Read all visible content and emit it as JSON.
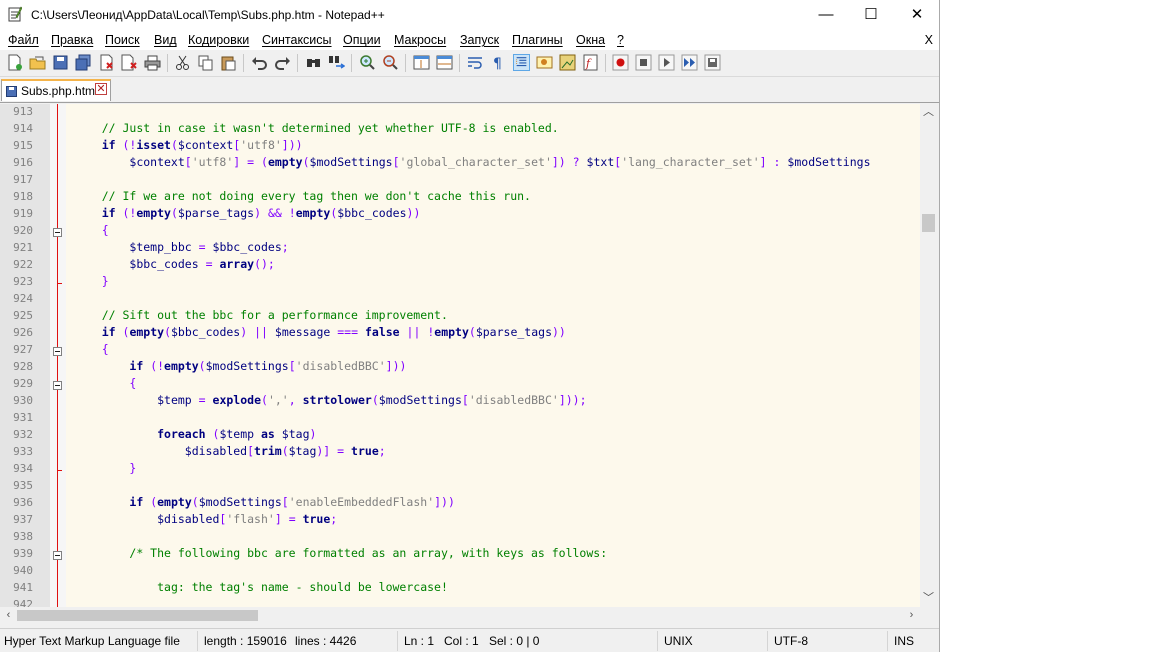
{
  "window": {
    "title": "C:\\Users\\Леонид\\AppData\\Local\\Temp\\Subs.php.htm - Notepad++",
    "minimize": "—",
    "maximize": "☐",
    "close": "✕"
  },
  "menu": {
    "items": [
      "Файл",
      "Правка",
      "Поиск",
      "Вид",
      "Кодировки",
      "Синтаксисы",
      "Опции",
      "Макросы",
      "Запуск",
      "Плагины",
      "Окна",
      "?"
    ],
    "close_doc": "X"
  },
  "toolbar": {
    "icons": [
      "new-file-icon",
      "open-file-icon",
      "save-icon",
      "save-all-icon",
      "close-icon",
      "close-all-icon",
      "print-icon",
      "cut-icon",
      "copy-icon",
      "paste-icon",
      "undo-icon",
      "redo-icon",
      "find-icon",
      "replace-icon",
      "zoom-in-icon",
      "zoom-out-icon",
      "sync-vertical-icon",
      "sync-horizontal-icon",
      "word-wrap-icon",
      "show-all-chars-icon",
      "indent-guide-icon",
      "user-language-icon",
      "document-map-icon",
      "function-list-icon",
      "record-macro-icon",
      "stop-record-icon",
      "play-macro-icon",
      "run-macro-multiple-icon",
      "save-macro-icon"
    ]
  },
  "tab": {
    "label": "Subs.php.htm",
    "close": "✕"
  },
  "editor": {
    "lines": [
      {
        "n": "913",
        "html": "",
        "fold": ""
      },
      {
        "n": "914",
        "html": "    <span class='c'>// Just in case it wasn't determined yet whether UTF-8 is enabled.</span>",
        "fold": "line"
      },
      {
        "n": "915",
        "html": "    <span class='k'>if</span> <span class='o'>(!</span><span class='k'>isset</span><span class='o'>(</span><span class='v'>$context</span><span class='o'>[</span><span class='s'>'utf8'</span><span class='o'>]))</span>",
        "fold": "line"
      },
      {
        "n": "916",
        "html": "        <span class='v'>$context</span><span class='o'>[</span><span class='s'>'utf8'</span><span class='o'>]</span> <span class='o'>=</span> <span class='o'>(</span><span class='k'>empty</span><span class='o'>(</span><span class='v'>$modSettings</span><span class='o'>[</span><span class='s'>'global_character_set'</span><span class='o'>])</span> <span class='o'>?</span> <span class='v'>$txt</span><span class='o'>[</span><span class='s'>'lang_character_set'</span><span class='o'>]</span> <span class='o'>:</span> <span class='v'>$modSettings</span>",
        "fold": "line"
      },
      {
        "n": "917",
        "html": "",
        "fold": "line"
      },
      {
        "n": "918",
        "html": "    <span class='c'>// If we are not doing every tag then we don't cache this run.</span>",
        "fold": "line"
      },
      {
        "n": "919",
        "html": "    <span class='k'>if</span> <span class='o'>(!</span><span class='k'>empty</span><span class='o'>(</span><span class='v'>$parse_tags</span><span class='o'>)</span> <span class='o'>&amp;&amp;</span> <span class='o'>!</span><span class='k'>empty</span><span class='o'>(</span><span class='v'>$bbc_codes</span><span class='o'>))</span>",
        "fold": "line"
      },
      {
        "n": "920",
        "html": "    <span class='o'>{</span>",
        "fold": "box"
      },
      {
        "n": "921",
        "html": "        <span class='v'>$temp_bbc</span> <span class='o'>=</span> <span class='v'>$bbc_codes</span><span class='o'>;</span>",
        "fold": "line"
      },
      {
        "n": "922",
        "html": "        <span class='v'>$bbc_codes</span> <span class='o'>=</span> <span class='k'>array</span><span class='o'>();</span>",
        "fold": "line"
      },
      {
        "n": "923",
        "html": "    <span class='o'>}</span>",
        "fold": "tick"
      },
      {
        "n": "924",
        "html": "",
        "fold": "line"
      },
      {
        "n": "925",
        "html": "    <span class='c'>// Sift out the bbc for a performance improvement.</span>",
        "fold": "line"
      },
      {
        "n": "926",
        "html": "    <span class='k'>if</span> <span class='o'>(</span><span class='k'>empty</span><span class='o'>(</span><span class='v'>$bbc_codes</span><span class='o'>)</span> <span class='o'>||</span> <span class='v'>$message</span> <span class='o'>===</span> <span class='k'>false</span> <span class='o'>||</span> <span class='o'>!</span><span class='k'>empty</span><span class='o'>(</span><span class='v'>$parse_tags</span><span class='o'>))</span>",
        "fold": "line"
      },
      {
        "n": "927",
        "html": "    <span class='o'>{</span>",
        "fold": "box"
      },
      {
        "n": "928",
        "html": "        <span class='k'>if</span> <span class='o'>(!</span><span class='k'>empty</span><span class='o'>(</span><span class='v'>$modSettings</span><span class='o'>[</span><span class='s'>'disabledBBC'</span><span class='o'>]))</span>",
        "fold": "line"
      },
      {
        "n": "929",
        "html": "        <span class='o'>{</span>",
        "fold": "box"
      },
      {
        "n": "930",
        "html": "            <span class='v'>$temp</span> <span class='o'>=</span> <span class='k'>explode</span><span class='o'>(</span><span class='s'>','</span><span class='o'>,</span> <span class='k'>strtolower</span><span class='o'>(</span><span class='v'>$modSettings</span><span class='o'>[</span><span class='s'>'disabledBBC'</span><span class='o'>]));</span>",
        "fold": "line"
      },
      {
        "n": "931",
        "html": "",
        "fold": "line"
      },
      {
        "n": "932",
        "html": "            <span class='k'>foreach</span> <span class='o'>(</span><span class='v'>$temp</span> <span class='k'>as</span> <span class='v'>$tag</span><span class='o'>)</span>",
        "fold": "line"
      },
      {
        "n": "933",
        "html": "                <span class='v'>$disabled</span><span class='o'>[</span><span class='k'>trim</span><span class='o'>(</span><span class='v'>$tag</span><span class='o'>)]</span> <span class='o'>=</span> <span class='k'>true</span><span class='o'>;</span>",
        "fold": "line"
      },
      {
        "n": "934",
        "html": "        <span class='o'>}</span>",
        "fold": "tick"
      },
      {
        "n": "935",
        "html": "",
        "fold": "line"
      },
      {
        "n": "936",
        "html": "        <span class='k'>if</span> <span class='o'>(</span><span class='k'>empty</span><span class='o'>(</span><span class='v'>$modSettings</span><span class='o'>[</span><span class='s'>'enableEmbeddedFlash'</span><span class='o'>]))</span>",
        "fold": "line"
      },
      {
        "n": "937",
        "html": "            <span class='v'>$disabled</span><span class='o'>[</span><span class='s'>'flash'</span><span class='o'>]</span> <span class='o'>=</span> <span class='k'>true</span><span class='o'>;</span>",
        "fold": "line"
      },
      {
        "n": "938",
        "html": "",
        "fold": "line"
      },
      {
        "n": "939",
        "html": "        <span class='c'>/* The following bbc are formatted as an array, with keys as follows:</span>",
        "fold": "box"
      },
      {
        "n": "940",
        "html": "",
        "fold": "line"
      },
      {
        "n": "941",
        "html": "            <span class='c'>tag: the tag's name - should be lowercase!</span>",
        "fold": "line"
      },
      {
        "n": "942",
        "html": "",
        "fold": "line"
      }
    ]
  },
  "status": {
    "filetype": "Hyper Text Markup Language file",
    "length": "length : 159016",
    "lines": "lines : 4426",
    "ln": "Ln : 1",
    "col": "Col : 1",
    "sel": "Sel : 0 | 0",
    "eol": "UNIX",
    "encoding": "UTF-8",
    "mode": "INS"
  },
  "colors": {
    "editor_bg": "#fdf9ec",
    "comment": "#008000",
    "keyword": "#000080",
    "string": "#808080",
    "operator": "#8000ff",
    "fold_line": "#e01010",
    "tab_accent": "#f5b44a"
  }
}
